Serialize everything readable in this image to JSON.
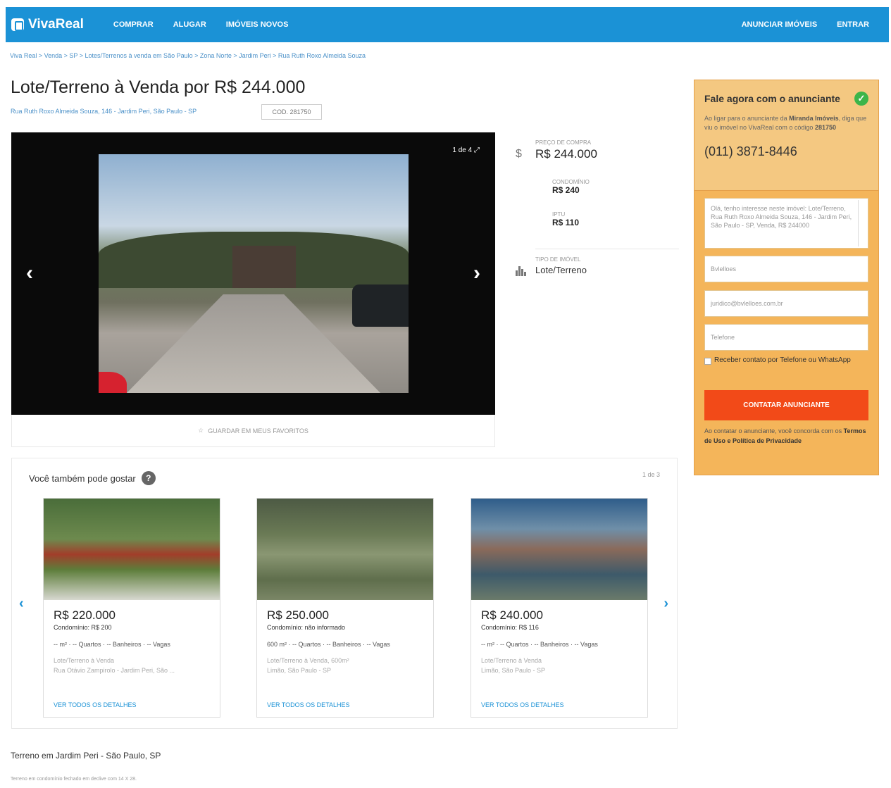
{
  "nav": {
    "logo": "VivaReal",
    "links": [
      "COMPRAR",
      "ALUGAR",
      "IMÓVEIS NOVOS"
    ],
    "right": [
      "ANUNCIAR IMÓVEIS",
      "ENTRAR"
    ]
  },
  "breadcrumb": "Viva Real > Venda > SP > Lotes/Terrenos à venda em São Paulo > Zona Norte > Jardim Peri > Rua Ruth Roxo Almeida Souza",
  "listing": {
    "title": "Lote/Terreno à Venda por R$ 244.000",
    "address": "Rua Ruth Roxo Almeida Souza, 146 - Jardim Peri, São Paulo - SP",
    "code": "COD. 281750"
  },
  "gallery": {
    "counter": "1 de 4",
    "favorite": "GUARDAR EM MEUS FAVORITOS"
  },
  "price": {
    "purchase_label": "PREÇO DE COMPRA",
    "purchase_value": "R$ 244.000",
    "condo_label": "CONDOMÍNIO",
    "condo_value": "R$ 240",
    "iptu_label": "IPTU",
    "iptu_value": "R$ 110",
    "type_label": "TIPO DE IMÓVEL",
    "type_value": "Lote/Terreno"
  },
  "contact": {
    "title": "Fale agora com o anunciante",
    "sub_pre": "Ao ligar para o anunciante da",
    "agency": "Miranda Imóveis",
    "sub_mid": ", diga que viu o imóvel no VivaReal com o código",
    "sub_code": "281750",
    "phone": "(011) 3871-8446",
    "message": "Olá, tenho interesse neste imóvel: Lote/Terreno, Rua Ruth Roxo Almeida Souza, 146 - Jardim Peri, São Paulo - SP, Venda, R$ 244000",
    "name_value": "Bvlelloes",
    "email_value": "juridico@bvlelloes.com.br",
    "phone_placeholder": "Telefone",
    "checkbox_label": "Receber contato por Telefone ou WhatsApp",
    "cta": "CONTATAR ANUNCIANTE",
    "terms_pre": "Ao contatar o anunciante, você concorda com os",
    "terms_link": "Termos de Uso e Política de Privacidade"
  },
  "suggestions": {
    "title": "Você também pode gostar",
    "page": "1 de 3",
    "cards": [
      {
        "price": "R$ 220.000",
        "condo": "Condomínio: R$ 200",
        "features": "-- m² · -- Quartos · -- Banheiros · -- Vagas",
        "type": "Lote/Terreno à Venda",
        "address": "Rua Otávio Zampirolo - Jardim Peri, São ...",
        "link": "VER TODOS OS DETALHES"
      },
      {
        "price": "R$ 250.000",
        "condo": "Condomínio: não informado",
        "features": "600 m² · -- Quartos · -- Banheiros · -- Vagas",
        "type": "Lote/Terreno à Venda, 600m²",
        "address": "Limão, São Paulo - SP",
        "link": "VER TODOS OS DETALHES"
      },
      {
        "price": "R$ 240.000",
        "condo": "Condomínio: R$ 116",
        "features": "-- m² · -- Quartos · -- Banheiros · -- Vagas",
        "type": "Lote/Terreno à Venda",
        "address": "Limão, São Paulo - SP",
        "link": "VER TODOS OS DETALHES"
      }
    ]
  },
  "description": {
    "title": "Terreno em Jardim Peri - São Paulo, SP",
    "text": "Terreno em condomínio fechado em declive com 14 X 28."
  },
  "colors": {
    "brand": "#1b92d6",
    "cta": "#f24a18",
    "contact_panel": "#f4b55a"
  }
}
